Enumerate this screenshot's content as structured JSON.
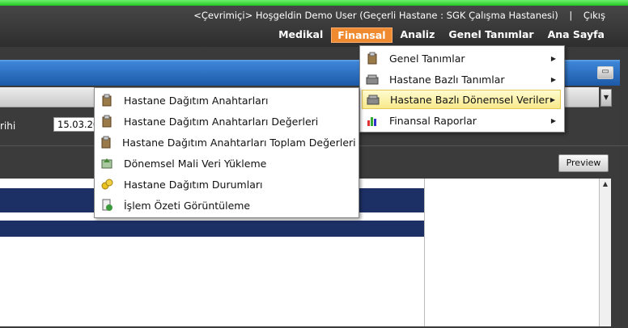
{
  "header": {
    "welcome_text": "<Çevrimiçi> Hoşgeldin Demo User (Geçerli Hastane : SGK Çalışma Hastanesi)",
    "separator": "|",
    "logout_label": "Çıkış",
    "nav": [
      {
        "label": "Medikal"
      },
      {
        "label": "Finansal"
      },
      {
        "label": "Analiz"
      },
      {
        "label": "Genel Tanımlar"
      },
      {
        "label": "Ana Sayfa"
      }
    ],
    "active_nav": "Finansal",
    "active_color": "#f08a30"
  },
  "form": {
    "date_label": "rihi",
    "date_value": "15.03.20",
    "preview_label": "Preview"
  },
  "finansal_menu": {
    "items": [
      {
        "label": "Genel Tanımlar",
        "icon": "clipboard-icon"
      },
      {
        "label": "Hastane Bazlı Tanımlar",
        "icon": "books-icon"
      },
      {
        "label": "Hastane Bazlı Dönemsel Veriler",
        "icon": "books-icon"
      },
      {
        "label": "Finansal Raporlar",
        "icon": "bar-chart-icon"
      }
    ],
    "highlighted": "Hastane Bazlı Dönemsel Veriler"
  },
  "submenu": {
    "items": [
      {
        "label": "Hastane Dağıtım Anahtarları",
        "icon": "clipboard-icon"
      },
      {
        "label": "Hastane Dağıtım Anahtarları Değerleri",
        "icon": "clipboard-icon"
      },
      {
        "label": "Hastane Dağıtım Anahtarları Toplam Değerleri",
        "icon": "clipboard-icon"
      },
      {
        "label": "Dönemsel Mali Veri Yükleme",
        "icon": "data-upload-icon"
      },
      {
        "label": "Hastane Dağıtım Durumları",
        "icon": "coins-icon"
      },
      {
        "label": "İşlem Özeti Görüntüleme",
        "icon": "document-view-icon"
      }
    ]
  },
  "colors": {
    "grid_header": "#1d3066",
    "panel_header": "#2a6fc4",
    "highlight": "#f8e98a"
  }
}
